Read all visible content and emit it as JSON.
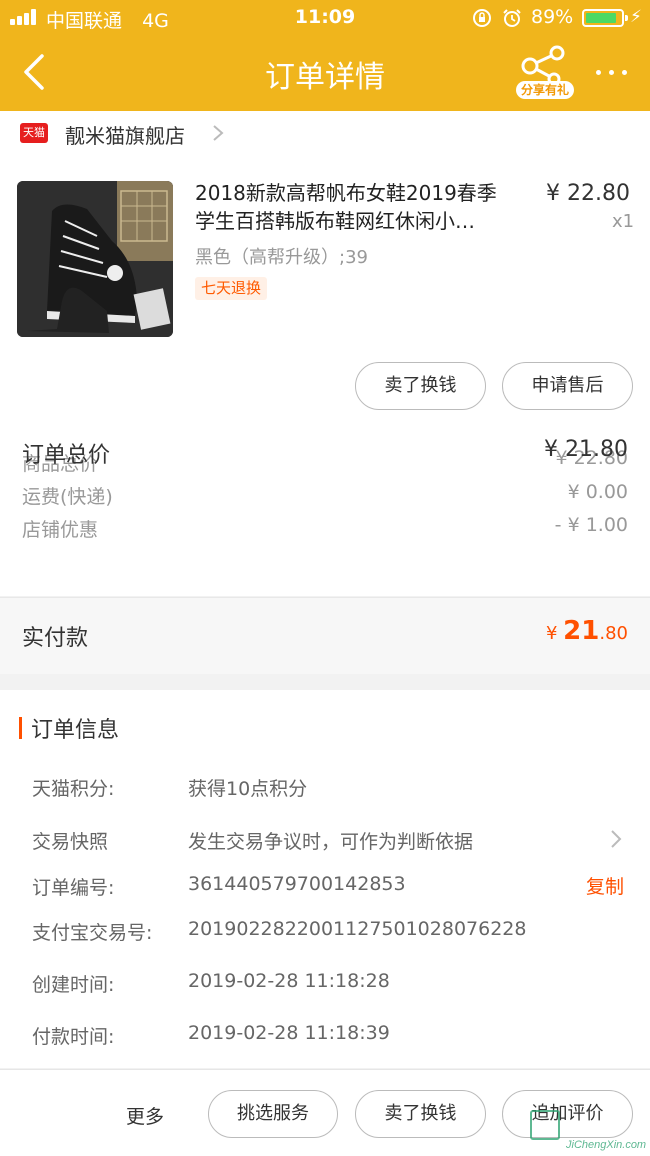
{
  "status_bar": {
    "carrier": "中国联通",
    "network": "4G",
    "time": "11:09",
    "battery": "89%",
    "battery_level": 0.89
  },
  "nav": {
    "title": "订单详情",
    "share_label": "分享有礼"
  },
  "shop": {
    "logo_text": "天猫",
    "name": "靓米猫旗舰店"
  },
  "product": {
    "title_line1": "2018新款高帮帆布女鞋2019春季",
    "title_line2": "学生百搭韩版布鞋网红休闲小…",
    "price": "¥ 22.80",
    "quantity": "x1",
    "sku": "黑色（高帮升级）;39",
    "badge": "七天退换"
  },
  "actions": {
    "sell": "卖了换钱",
    "after_sale": "申请售后"
  },
  "summary": {
    "goods_label": "商品总价",
    "goods_value": "¥ 22.80",
    "shipping_label": "运费(快递)",
    "shipping_value": "¥ 0.00",
    "discount_label": "店铺优惠",
    "discount_value": "- ¥ 1.00",
    "total_label": "订单总价",
    "total_value": "¥ 21.80"
  },
  "paid": {
    "label": "实付款",
    "currency": "¥ ",
    "int": "21",
    "dec": ".80"
  },
  "order_info": {
    "title": "订单信息",
    "points_label": "天猫积分:",
    "points_value": "获得10点积分",
    "snapshot_label": "交易快照",
    "snapshot_value": "发生交易争议时，可作为判断依据",
    "order_no_label": "订单编号:",
    "order_no_value": "361440579700142853",
    "copy_label": "复制",
    "alipay_label": "支付宝交易号:",
    "alipay_value": "2019022822001127501028076228",
    "created_label": "创建时间:",
    "created_value": "2019-02-28 11:18:28",
    "paid_time_label": "付款时间:",
    "paid_time_value": "2019-02-28 11:18:39"
  },
  "bottom_bar": {
    "more": "更多",
    "select_service": "挑选服务",
    "sell": "卖了换钱",
    "add_review": "追加评价"
  },
  "watermark": {
    "text": "JiChengXin.com"
  },
  "colors": {
    "header": "#f0b51c",
    "accent": "#ff5000",
    "tmall_red": "#e61e1e"
  }
}
